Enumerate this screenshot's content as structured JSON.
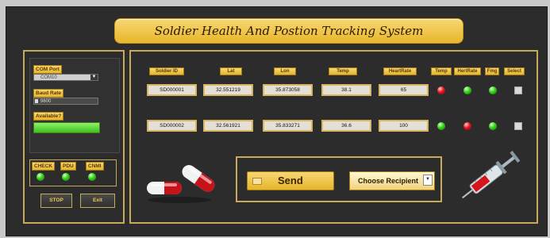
{
  "title": "Soldier Health And Postion Tracking System",
  "connection": {
    "com_port_label": "COM Port",
    "com_port_value": "COM10",
    "baud_rate_label": "Baud Rate",
    "baud_rate_value": "9600",
    "available_label": "Available?",
    "available_fill": 1.0
  },
  "indicators": [
    {
      "label": "CHECK",
      "state": "green"
    },
    {
      "label": "PDU",
      "state": "green"
    },
    {
      "label": "CNMI",
      "state": "green"
    }
  ],
  "buttons": {
    "stop": "STOP",
    "exit": "Exit",
    "send": "Send"
  },
  "recipient_label": "Choose Recipient",
  "columns": [
    "Soldier ID",
    "Lat",
    "Lon",
    "Temp",
    "HeartRate",
    "Temp",
    "HertRate",
    "Fmg",
    "Select"
  ],
  "rows": [
    {
      "id": "SD000001",
      "lat": "32.551219",
      "lon": "35.873058",
      "temp": "38.1",
      "heartrate": "65",
      "temp_status": "red",
      "hr_status": "green",
      "fmg_status": "green"
    },
    {
      "id": "SD000002",
      "lat": "32.561921",
      "lon": "35.833271",
      "temp": "36.6",
      "heartrate": "100",
      "temp_status": "green",
      "hr_status": "red",
      "fmg_status": "green"
    }
  ],
  "icons": {
    "pills": "pills-icon",
    "syringe": "syringe-icon"
  },
  "colors": {
    "gold": "#e6b52a",
    "panel_bg": "#2c2c2c",
    "led_green": "#35d01a",
    "led_red": "#e8141a"
  }
}
